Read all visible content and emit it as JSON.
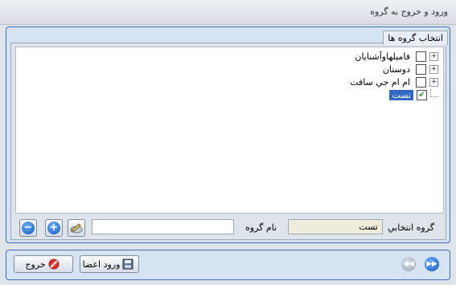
{
  "window": {
    "title": "ورود و خروج به گروه"
  },
  "groups_panel": {
    "legend": "انتخاب گروه ها"
  },
  "tree": {
    "items": [
      {
        "label": "فاميلهاوآشنايان",
        "checked": false,
        "expander": "+"
      },
      {
        "label": "دوستان",
        "checked": false,
        "expander": "+"
      },
      {
        "label": "ام ام جي سافت",
        "checked": false,
        "expander": "+"
      },
      {
        "label": "تست",
        "checked": true,
        "selected": true,
        "check_glyph": "✔"
      }
    ]
  },
  "selected_group": {
    "label": "گروه انتخابي",
    "value": "تست"
  },
  "group_name": {
    "label": "نام گروه",
    "value": ""
  },
  "buttons": {
    "exit": "خروج",
    "enter_members": "ورود اعضا",
    "add_glyph": "+",
    "remove_glyph": "−"
  },
  "colors": {
    "accent": "#3d6fb5",
    "selection": "#3168c4",
    "check": "#2a9b2a"
  }
}
